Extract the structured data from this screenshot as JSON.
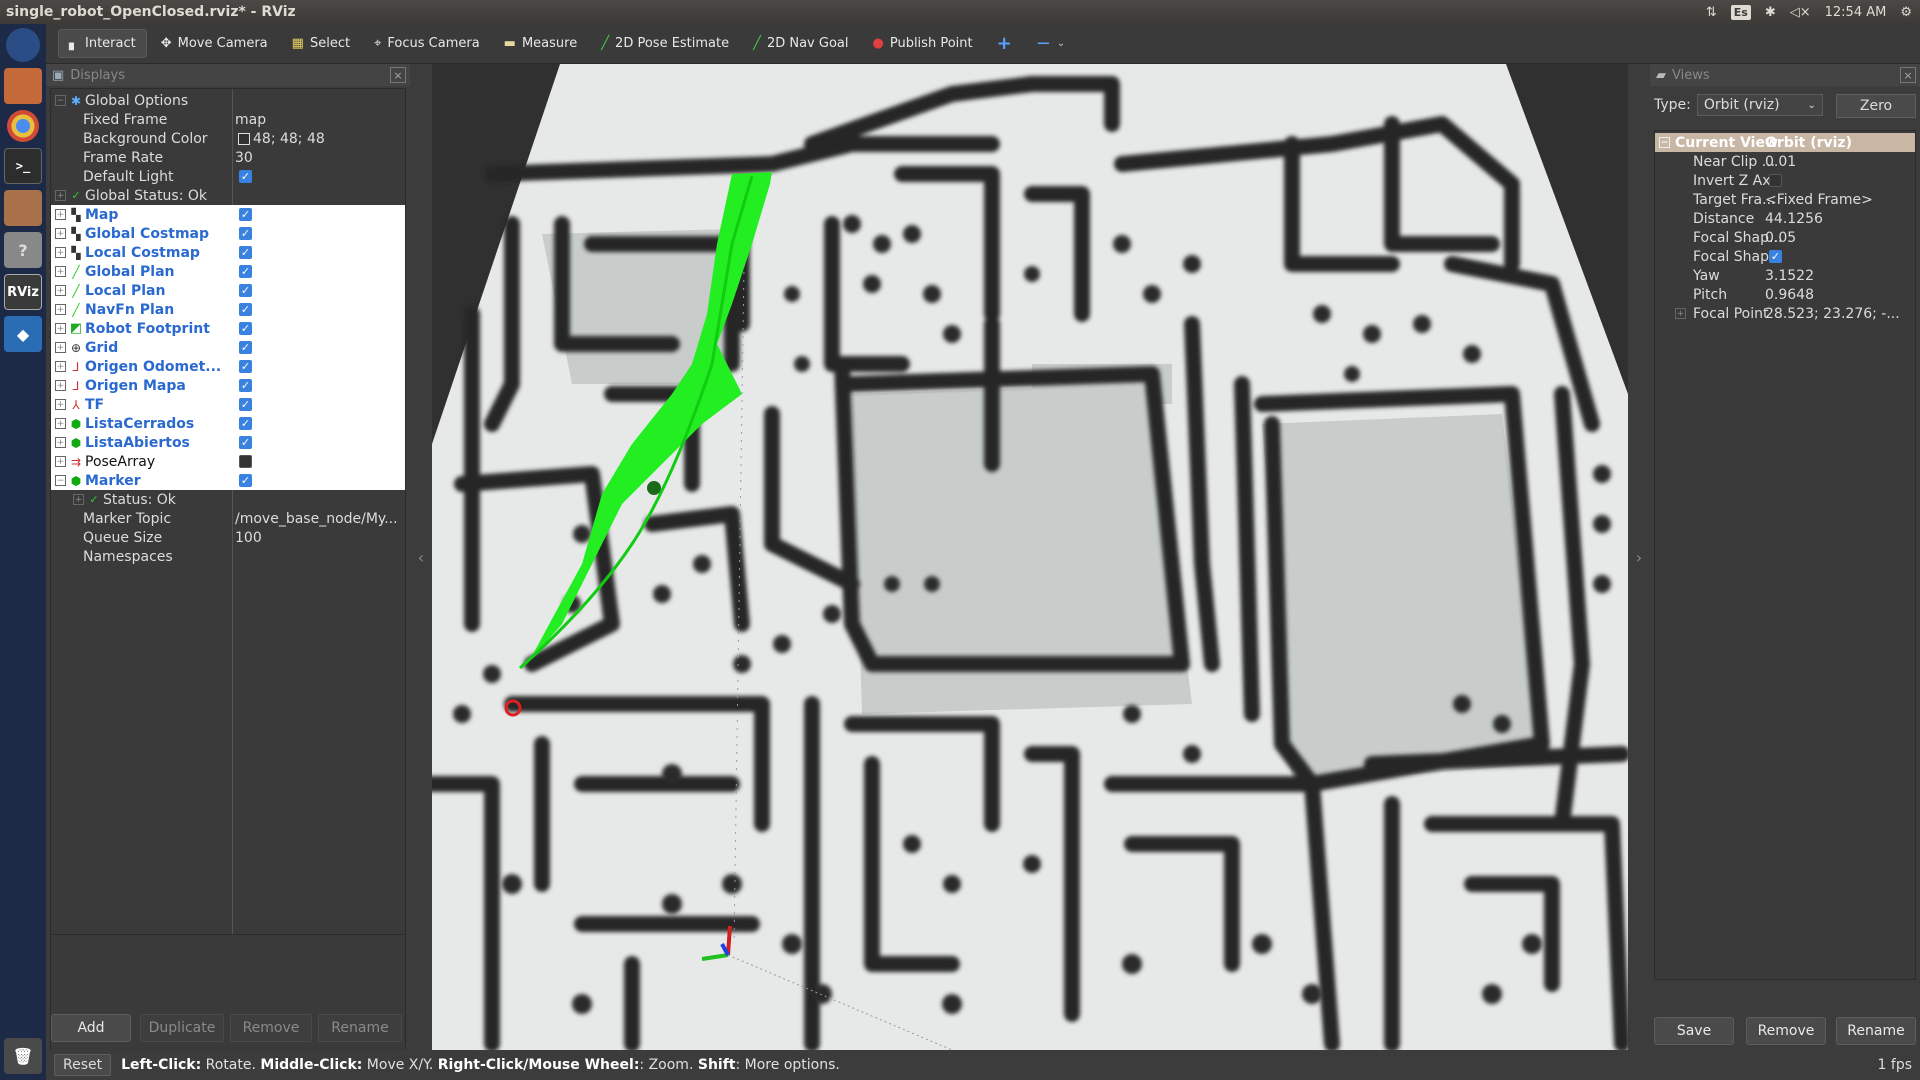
{
  "window": {
    "title": "single_robot_OpenClosed.rviz* - RViz"
  },
  "system_tray": {
    "keyboard_layout": "Es",
    "clock": "12:54 AM"
  },
  "launcher": {
    "items": [
      {
        "name": "dash",
        "glyph": ""
      },
      {
        "name": "files",
        "glyph": ""
      },
      {
        "name": "chrome",
        "glyph": ""
      },
      {
        "name": "terminal",
        "glyph": ">_"
      },
      {
        "name": "files2",
        "glyph": ""
      },
      {
        "name": "help",
        "glyph": "?"
      },
      {
        "name": "rviz",
        "glyph": "RViz"
      },
      {
        "name": "vscode",
        "glyph": "◆"
      }
    ]
  },
  "toolbar": {
    "tools": [
      {
        "label": "Interact",
        "icon": "cursor-icon",
        "glyph": "▖",
        "active": true
      },
      {
        "label": "Move Camera",
        "icon": "move-icon",
        "glyph": "✥"
      },
      {
        "label": "Select",
        "icon": "select-icon",
        "glyph": "▦"
      },
      {
        "label": "Focus Camera",
        "icon": "crosshair-icon",
        "glyph": "⌖"
      },
      {
        "label": "Measure",
        "icon": "ruler-icon",
        "glyph": "▬"
      },
      {
        "label": "2D Pose Estimate",
        "icon": "green-arrow-icon",
        "glyph": "╱"
      },
      {
        "label": "2D Nav Goal",
        "icon": "green-arrow-icon",
        "glyph": "╱"
      },
      {
        "label": "Publish Point",
        "icon": "pin-icon",
        "glyph": "●"
      }
    ]
  },
  "displays_panel": {
    "title": "Displays",
    "global_options": {
      "label": "Global Options",
      "props": [
        {
          "label": "Fixed Frame",
          "value": "map"
        },
        {
          "label": "Background Color",
          "value": "48; 48; 48"
        },
        {
          "label": "Frame Rate",
          "value": "30"
        },
        {
          "label": "Default Light",
          "value": ""
        }
      ],
      "status": "Global Status: Ok"
    },
    "items": [
      {
        "label": "Map",
        "icon": "map-icon",
        "checked": true
      },
      {
        "label": "Global Costmap",
        "icon": "map-icon",
        "checked": true
      },
      {
        "label": "Local Costmap",
        "icon": "map-icon",
        "checked": true
      },
      {
        "label": "Global Plan",
        "icon": "path-icon",
        "checked": true
      },
      {
        "label": "Local Plan",
        "icon": "path-icon",
        "checked": true
      },
      {
        "label": "NavFn Plan",
        "icon": "path-icon",
        "checked": true
      },
      {
        "label": "Robot Footprint",
        "icon": "polygon-icon",
        "checked": true
      },
      {
        "label": "Grid",
        "icon": "grid-icon",
        "checked": true
      },
      {
        "label": "Origen Odomet...",
        "icon": "axes-icon",
        "checked": true
      },
      {
        "label": "Origen Mapa",
        "icon": "axes-icon",
        "checked": true
      },
      {
        "label": "TF",
        "icon": "tf-icon",
        "checked": true
      },
      {
        "label": "ListaCerrados",
        "icon": "marker-icon",
        "checked": true
      },
      {
        "label": "ListaAbiertos",
        "icon": "marker-icon",
        "checked": true
      },
      {
        "label": "PoseArray",
        "icon": "posearray-icon",
        "checked": false
      },
      {
        "label": "Marker",
        "icon": "marker-icon",
        "checked": true
      }
    ],
    "marker_props": [
      {
        "label": "Status: Ok",
        "value": ""
      },
      {
        "label": "Marker Topic",
        "value": "/move_base_node/My..."
      },
      {
        "label": "Queue Size",
        "value": "100"
      },
      {
        "label": "Namespaces",
        "value": ""
      }
    ],
    "buttons": {
      "add": "Add",
      "duplicate": "Duplicate",
      "remove": "Remove",
      "rename": "Rename"
    }
  },
  "views_panel": {
    "title": "Views",
    "type_label": "Type:",
    "type_value": "Orbit (rviz)",
    "zero_label": "Zero",
    "current_view": {
      "label": "Current View",
      "value": "Orbit (rviz)"
    },
    "props": [
      {
        "label": "Near Clip ...",
        "value": "0.01"
      },
      {
        "label": "Invert Z Axis",
        "value": "",
        "checkbox": false
      },
      {
        "label": "Target Fra...",
        "value": "<Fixed Frame>"
      },
      {
        "label": "Distance",
        "value": "44.1256"
      },
      {
        "label": "Focal Shap...",
        "value": "0.05"
      },
      {
        "label": "Focal Shap...",
        "value": "",
        "checkbox": true
      },
      {
        "label": "Yaw",
        "value": "3.1522"
      },
      {
        "label": "Pitch",
        "value": "0.9648"
      },
      {
        "label": "Focal Point",
        "value": "28.523; 23.276; -..."
      }
    ],
    "buttons": {
      "save": "Save",
      "remove": "Remove",
      "rename": "Rename"
    }
  },
  "statusbar": {
    "reset": "Reset",
    "hint_parts": [
      {
        "bold": "Left-Click:",
        "text": " Rotate. "
      },
      {
        "bold": "Middle-Click:",
        "text": " Move X/Y. "
      },
      {
        "bold": "Right-Click/Mouse Wheel:",
        "text": ": Zoom. "
      },
      {
        "bold": "Shift",
        "text": ": More options."
      }
    ],
    "fps": "1 fps"
  },
  "colors": {
    "plan_green": "#22ee22",
    "obstacle": "#262626",
    "floor": "#e9ecec",
    "checkbox": "#3a82e0"
  }
}
